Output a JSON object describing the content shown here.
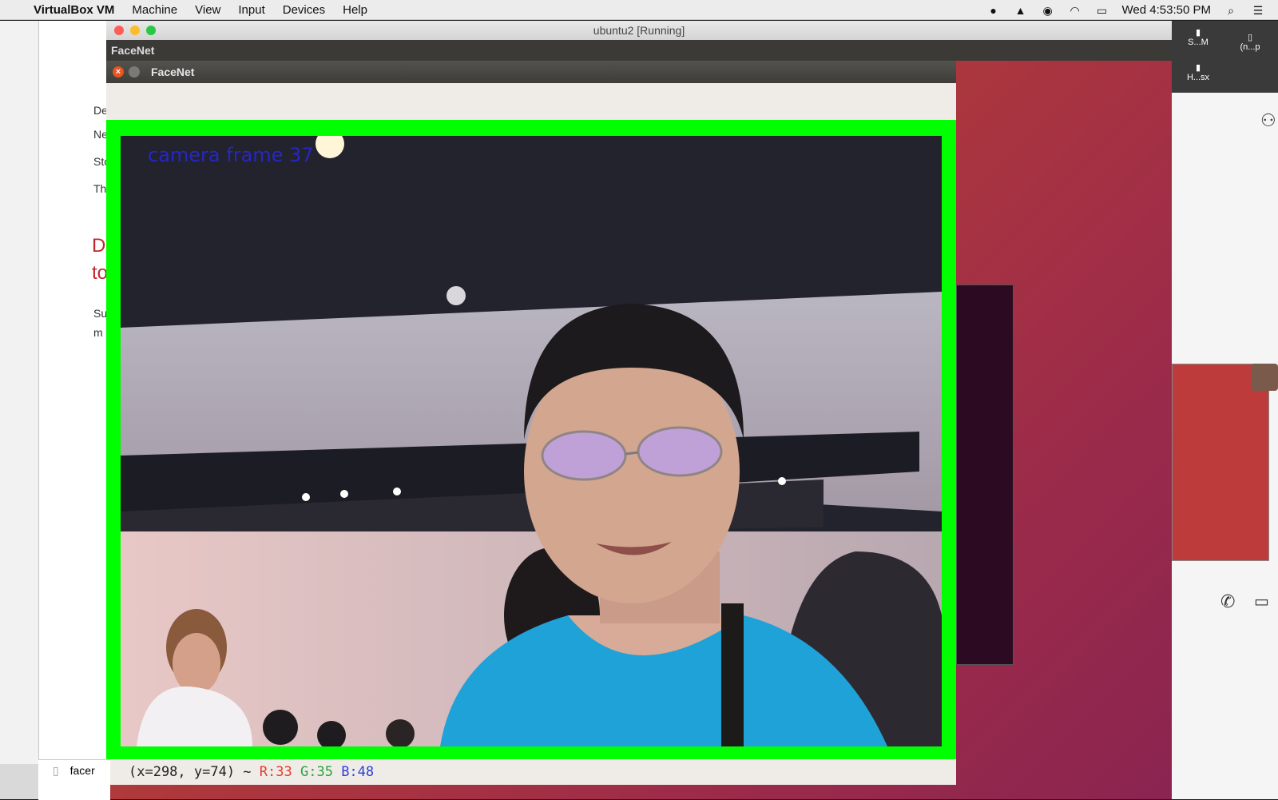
{
  "menubar": {
    "app": "VirtualBox VM",
    "items": [
      "Machine",
      "View",
      "Input",
      "Devices",
      "Help"
    ],
    "clock": "Wed 4:53:50 PM"
  },
  "vm_window": {
    "title": "ubuntu2 [Running]"
  },
  "ubuntu_panel": {
    "app_title": "FaceNet"
  },
  "facenet_window": {
    "title": "FaceNet",
    "overlay_text": "camera frame 37",
    "status": {
      "coords": "(x=298, y=74) ~",
      "r": "R:33",
      "g": "G:35",
      "b": "B:48"
    }
  },
  "left_window": {
    "lines": [
      "De",
      "Ne",
      "Sto",
      "Th"
    ],
    "red_heading": [
      "D",
      "to"
    ],
    "body": [
      "Su",
      "m"
    ],
    "bottom_file": "facer"
  },
  "right_pane": {
    "files": [
      "S...M",
      "(n...p",
      "H...sx"
    ]
  },
  "colors": {
    "frame_border": "#00ff00",
    "status_r": "#e53b2c",
    "status_g": "#2aa33a",
    "status_b": "#2c3fd6",
    "overlay": "#2626c8"
  }
}
